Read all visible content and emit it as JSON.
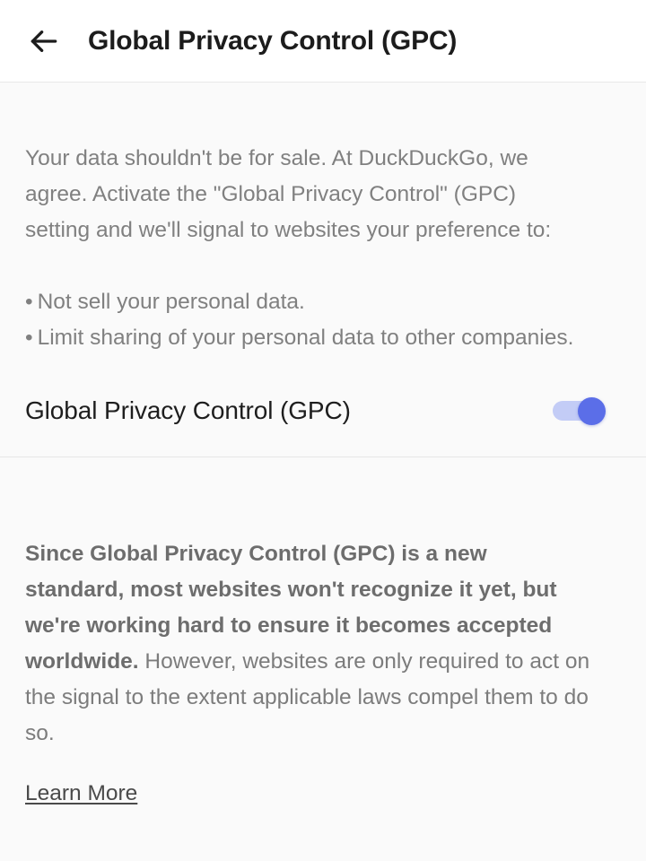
{
  "header": {
    "back_icon": "arrow-left-icon",
    "title": "Global Privacy Control (GPC)"
  },
  "intro": {
    "paragraph": "Your data shouldn't be for sale. At DuckDuckGo, we agree. Activate the \"Global Privacy Control\" (GPC) setting and we'll signal to websites your preference to:",
    "bullet_glyph": "•",
    "bullets": [
      "Not sell your personal data.",
      "Limit sharing of your personal data to other companies."
    ]
  },
  "setting": {
    "label": "Global Privacy Control (GPC)",
    "toggle_state": "on",
    "toggle_track_color": "#c3ccf6",
    "toggle_thumb_color": "#5b6ee8"
  },
  "footnote": {
    "bold_part": "Since Global Privacy Control (GPC) is a new standard, most websites won't recognize it yet, but we're working hard to ensure it becomes accepted worldwide.",
    "rest_part": " However, websites are only required to act on the signal to the extent applicable laws compel them to do so.",
    "link_label": "Learn More"
  }
}
